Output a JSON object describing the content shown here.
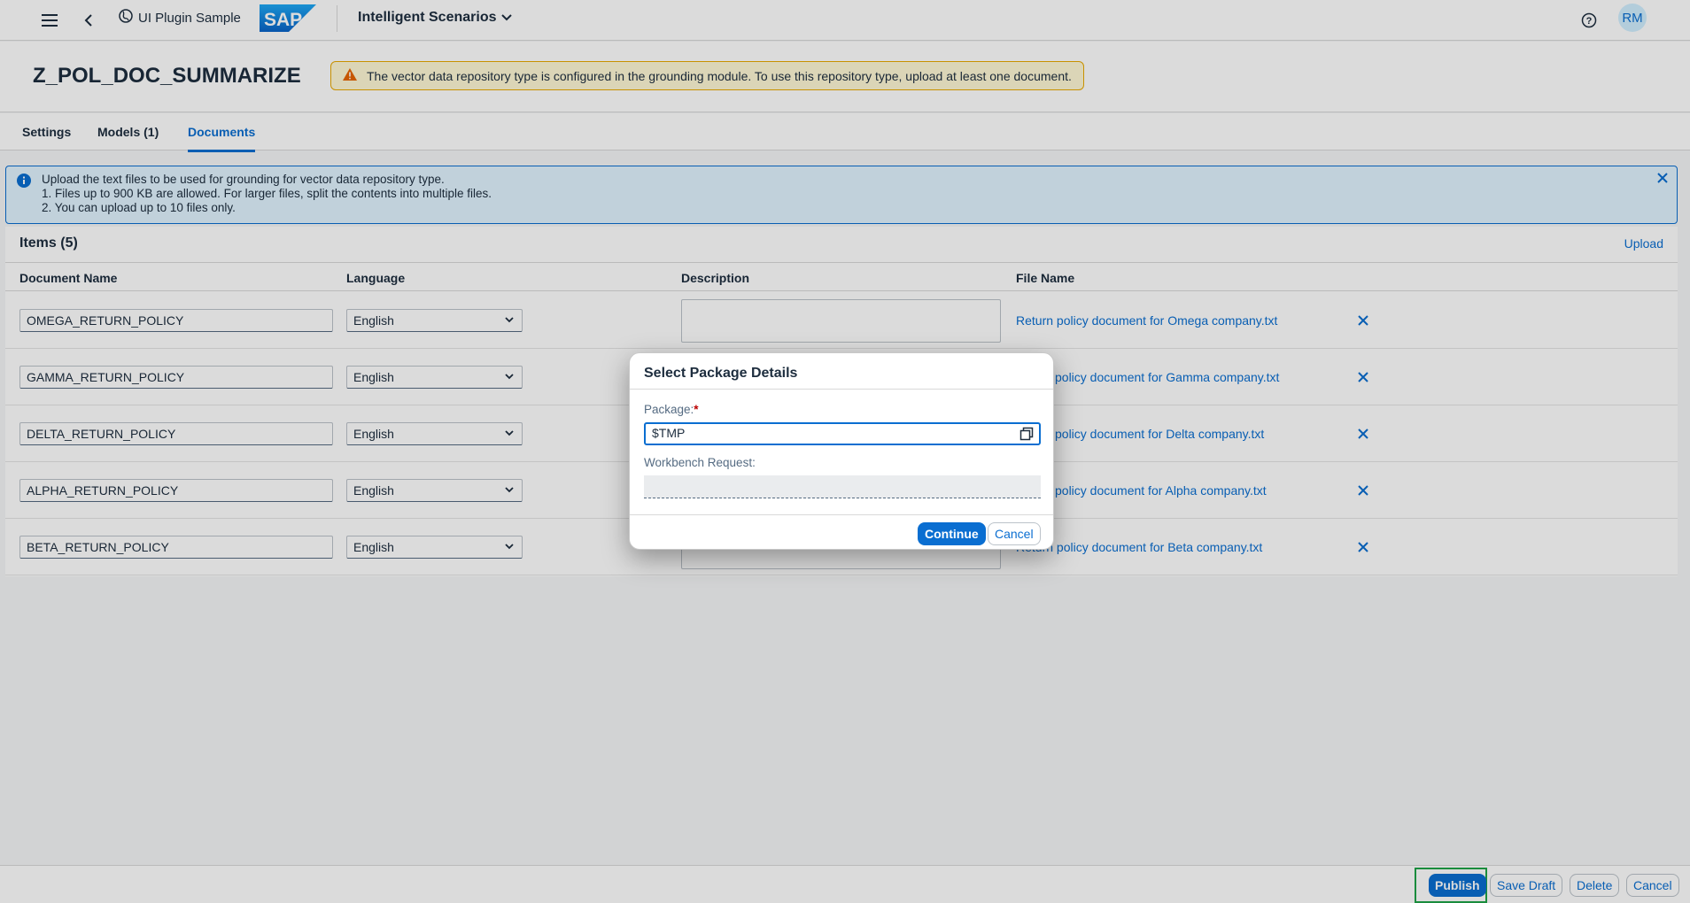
{
  "shell": {
    "app_name": "UI Plugin Sample",
    "logo_text": "SAP",
    "scenario_label": "Intelligent Scenarios",
    "avatar_initials": "RM"
  },
  "object": {
    "title": "Z_POL_DOC_SUMMARIZE",
    "warning": "The vector data repository type is configured in the grounding module. To use this repository type, upload at least one document."
  },
  "tabs": [
    {
      "label": "Settings"
    },
    {
      "label": "Models (1)"
    },
    {
      "label": "Documents"
    }
  ],
  "info": {
    "line1": "Upload the text files to be used for grounding for vector data repository type.",
    "line2": "1. Files up to 900 KB are allowed. For larger files, split the contents into multiple files.",
    "line3": "2. You can upload up to 10 files only."
  },
  "table": {
    "title": "Items (5)",
    "upload_label": "Upload",
    "columns": [
      "Document Name",
      "Language",
      "Description",
      "File Name"
    ],
    "rows": [
      {
        "doc_name": "OMEGA_RETURN_POLICY",
        "language": "English",
        "file": "Return policy document for Omega company.txt"
      },
      {
        "doc_name": "GAMMA_RETURN_POLICY",
        "language": "English",
        "file": "policy document for Gamma company.txt"
      },
      {
        "doc_name": "DELTA_RETURN_POLICY",
        "language": "English",
        "file": "policy document for Delta company.txt"
      },
      {
        "doc_name": "ALPHA_RETURN_POLICY",
        "language": "English",
        "file": "policy document for Alpha company.txt"
      },
      {
        "doc_name": "BETA_RETURN_POLICY",
        "language": "English",
        "file": "Return policy document for Beta company.txt"
      }
    ]
  },
  "dialog": {
    "title": "Select Package Details",
    "package_label": "Package:",
    "package_value": "$TMP",
    "workbench_label": "Workbench Request:",
    "continue_label": "Continue",
    "cancel_label": "Cancel"
  },
  "footer": {
    "publish": "Publish",
    "save_draft": "Save Draft",
    "delete": "Delete",
    "cancel": "Cancel"
  },
  "colors": {
    "accent": "#0a6ed1",
    "warning_bg": "#fff8d6",
    "info_bg": "#e1f4ff",
    "highlight": "#1fa347"
  }
}
